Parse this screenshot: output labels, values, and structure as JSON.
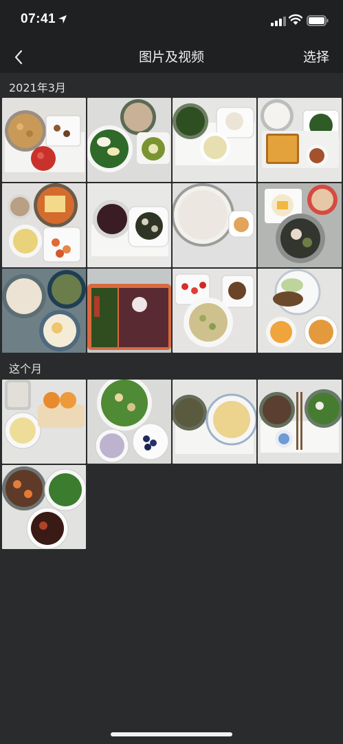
{
  "status_bar": {
    "time": "07:41"
  },
  "nav": {
    "title": "图片及视频",
    "select_label": "选择"
  },
  "sections": [
    {
      "header": "2021年3月",
      "photo_count": 12
    },
    {
      "header": "这个月",
      "photo_count": 5
    }
  ],
  "colors": {
    "background": "#2a2b2c",
    "bar_background": "#1f2021",
    "text": "#f0f0f0"
  }
}
